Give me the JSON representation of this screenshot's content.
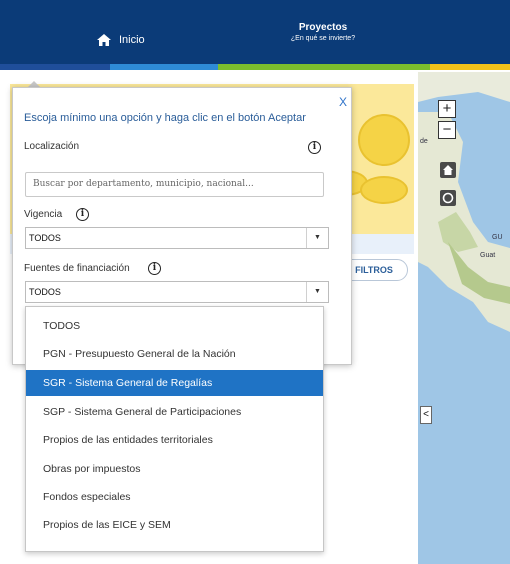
{
  "colors": {
    "header_bg": "#0b3b78",
    "accent": [
      "#1f4e9a",
      "#2e8bd6",
      "#7bbd2e",
      "#f2c21a"
    ],
    "link": "#2a5d99",
    "selected_option_bg": "#1f73c5",
    "map_water": "#9fc6e6"
  },
  "header": {
    "home": {
      "icon": "home-icon",
      "label": "Inicio"
    },
    "projects": {
      "title": "Proyectos",
      "subtitle": "¿En qué se invierte?"
    }
  },
  "background": {
    "filtros_label": "FILTROS"
  },
  "map": {
    "zoom_in_label": "+",
    "zoom_out_label": "−",
    "labels": [
      "de",
      "GU",
      "Guat"
    ],
    "collapse_label": "<",
    "icons": [
      "home-icon",
      "locate-icon"
    ]
  },
  "filter_popup": {
    "close_label": "X",
    "instruction": "Escoja mínimo una opción y haga clic en el botón Aceptar",
    "location": {
      "label": "Localización",
      "placeholder": "Buscar por departamento, municipio, nacional..."
    },
    "vigencia": {
      "label": "Vigencia",
      "selected": "TODOS"
    },
    "fuentes": {
      "label": "Fuentes de financiación",
      "selected": "TODOS",
      "options": [
        "TODOS",
        "PGN - Presupuesto General de la Nación",
        "SGR - Sistema General de Regalías",
        "SGP - Sistema General de Participaciones",
        "Propios de las entidades territoriales",
        "Obras por impuestos",
        "Fondos especiales",
        "Propios de las EICE y SEM"
      ],
      "highlighted_option": "SGR - Sistema General de Regalías"
    },
    "info_glyph": "i"
  }
}
